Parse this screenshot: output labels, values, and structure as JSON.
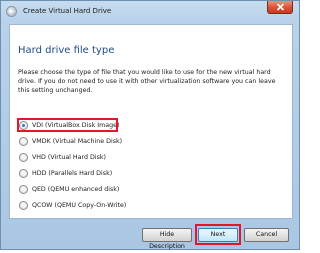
{
  "window": {
    "title": "Create Virtual Hard Drive"
  },
  "page": {
    "heading": "Hard drive file type",
    "description": "Please choose the type of file that you would like to use for the new virtual hard drive. If you do not need to use it with other virtualization software you can leave this setting unchanged."
  },
  "options": [
    {
      "label": "VDI (VirtualBox Disk Image)",
      "selected": true
    },
    {
      "label": "VMDK (Virtual Machine Disk)",
      "selected": false
    },
    {
      "label": "VHD (Virtual Hard Disk)",
      "selected": false
    },
    {
      "label": "HDD (Parallels Hard Disk)",
      "selected": false
    },
    {
      "label": "QED (QEMU enhanced disk)",
      "selected": false
    },
    {
      "label": "QCOW (QEMU Copy-On-Write)",
      "selected": false
    }
  ],
  "buttons": {
    "hide_description": "Hide Description",
    "next": "Next",
    "cancel": "Cancel"
  },
  "colors": {
    "highlight": "#e0182a",
    "heading": "#1f4a86"
  }
}
